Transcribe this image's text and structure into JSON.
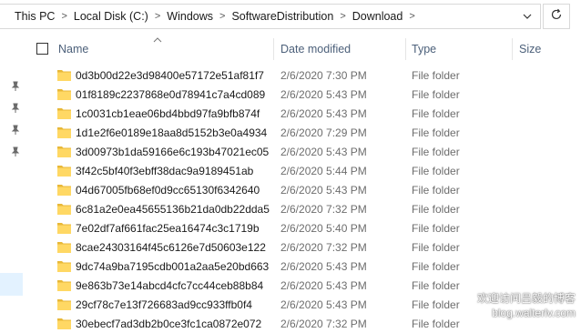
{
  "address_bar": {
    "breadcrumbs": [
      "This PC",
      "Local Disk (C:)",
      "Windows",
      "SoftwareDistribution",
      "Download"
    ]
  },
  "columns": {
    "name": "Name",
    "date_modified": "Date modified",
    "type": "Type",
    "size": "Size"
  },
  "files": [
    {
      "name": "0d3b00d22e3d98400e57172e51af81f7",
      "date": "2/6/2020 7:30 PM",
      "type": "File folder"
    },
    {
      "name": "01f8189c2237868e0d78941c7a4cd089",
      "date": "2/6/2020 5:43 PM",
      "type": "File folder"
    },
    {
      "name": "1c0031cb1eae06bd4bbd97fa9bfb874f",
      "date": "2/6/2020 5:43 PM",
      "type": "File folder"
    },
    {
      "name": "1d1e2f6e0189e18aa8d5152b3e0a4934",
      "date": "2/6/2020 7:29 PM",
      "type": "File folder"
    },
    {
      "name": "3d00973b1da59166e6c193b47021ec05",
      "date": "2/6/2020 5:43 PM",
      "type": "File folder"
    },
    {
      "name": "3f42c5bf40f3ebff38dac9a9189451ab",
      "date": "2/6/2020 5:44 PM",
      "type": "File folder"
    },
    {
      "name": "04d67005fb68ef0d9cc65130f6342640",
      "date": "2/6/2020 5:43 PM",
      "type": "File folder"
    },
    {
      "name": "6c81a2e0ea45655136b21da0db22dda5",
      "date": "2/6/2020 7:32 PM",
      "type": "File folder"
    },
    {
      "name": "7e02df7af661fac25ea16474c3c1719b",
      "date": "2/6/2020 5:40 PM",
      "type": "File folder"
    },
    {
      "name": "8cae24303164f45c6126e7d50603e122",
      "date": "2/6/2020 7:32 PM",
      "type": "File folder"
    },
    {
      "name": "9dc74a9ba7195cdb001a2aa5e20bd663",
      "date": "2/6/2020 5:43 PM",
      "type": "File folder"
    },
    {
      "name": "9e863b73e14abcd4cfc7cc44ceb88b84",
      "date": "2/6/2020 5:43 PM",
      "type": "File folder"
    },
    {
      "name": "29cf78c7e13f726683ad9cc933ffb0f4",
      "date": "2/6/2020 5:43 PM",
      "type": "File folder"
    },
    {
      "name": "30ebecf7ad3db2b0ce3fc1ca0872e072",
      "date": "2/6/2020 7:32 PM",
      "type": "File folder"
    }
  ],
  "icons": {
    "folder": "folder-icon",
    "pin": "pin-icon",
    "refresh": "refresh-icon",
    "dropdown": "chevron-down-icon",
    "sort": "sort-up-icon"
  },
  "colors": {
    "folder": "#ffd864",
    "folder_dark": "#e8b838",
    "header_text": "#4c607a",
    "secondary_text": "#6d6d6d",
    "selection": "#cce8ff"
  },
  "watermark": {
    "line1": "欢迎访问吕毅的博客",
    "line2": "blog.walterlv.com"
  }
}
